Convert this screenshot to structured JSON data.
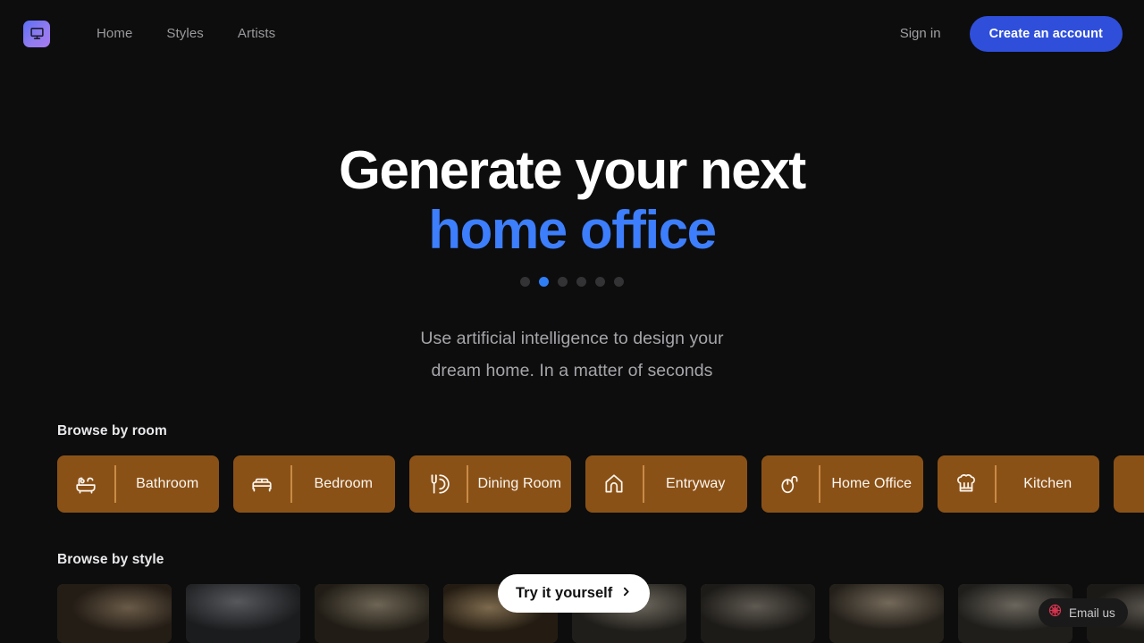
{
  "brand": {
    "logo_icon": "monitor-icon",
    "gradient_from": "#5b6ef5",
    "gradient_to": "#a87af0"
  },
  "nav": {
    "links": [
      {
        "label": "Home"
      },
      {
        "label": "Styles"
      },
      {
        "label": "Artists"
      }
    ],
    "signin_label": "Sign in",
    "cta_label": "Create an account",
    "cta_color": "#2f4fdb"
  },
  "hero": {
    "headline_line1": "Generate your next",
    "headline_line2": "home office",
    "accent_color": "#3d7efc",
    "subtitle_line1": "Use artificial intelligence to design your",
    "subtitle_line2": "dream home. In a matter of seconds",
    "carousel": {
      "total_dots": 6,
      "active_index": 1,
      "active_color": "#2f7ef5",
      "inactive_color": "#333336"
    }
  },
  "browse_room": {
    "label": "Browse by room",
    "card_color": "#8a5117",
    "cards": [
      {
        "label": "Bathroom",
        "icon": "bathtub-icon"
      },
      {
        "label": "Bedroom",
        "icon": "bed-icon"
      },
      {
        "label": "Dining Room",
        "icon": "cutlery-icon"
      },
      {
        "label": "Entryway",
        "icon": "arch-door-icon"
      },
      {
        "label": "Home Office",
        "icon": "mouse-icon"
      },
      {
        "label": "Kitchen",
        "icon": "chef-hat-icon"
      },
      {
        "label": "",
        "icon": "partial-card"
      }
    ]
  },
  "browse_style": {
    "label": "Browse by style",
    "cards": [
      {
        "name": "style-thumb-1"
      },
      {
        "name": "style-thumb-2"
      },
      {
        "name": "style-thumb-3"
      },
      {
        "name": "style-thumb-4"
      },
      {
        "name": "style-thumb-5"
      },
      {
        "name": "style-thumb-6"
      },
      {
        "name": "style-thumb-7"
      },
      {
        "name": "style-thumb-8"
      },
      {
        "name": "style-thumb-9"
      },
      {
        "name": "style-thumb-10"
      }
    ]
  },
  "floating": {
    "try_label": "Try it yourself",
    "try_chevron": "chevron-right-icon",
    "email_label": "Email us",
    "email_icon": "email-widget-icon",
    "email_icon_color": "#d8344f"
  }
}
